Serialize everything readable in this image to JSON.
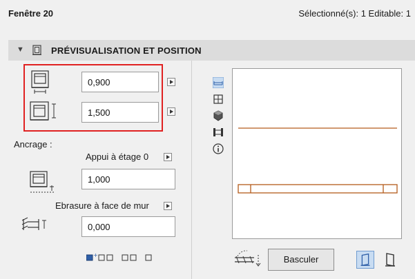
{
  "header": {
    "title": "Fenêtre 20",
    "status": "Sélectionné(s): 1 Editable: 1"
  },
  "section": {
    "title": "PRÉVISUALISATION ET POSITION",
    "expanded": true
  },
  "dimensions": {
    "width_value": "0,900",
    "height_value": "1,500"
  },
  "anchor": {
    "label": "Ancrage :",
    "reference_label": "Appui à étage 0",
    "reference_value": "1,000",
    "reveal_label": "Ebrasure à face de mur",
    "reveal_value": "0,000"
  },
  "preview": {
    "flip_button": "Basculer"
  },
  "colors": {
    "highlight": "#e02020",
    "preview_line": "#b35a1a",
    "toggle_active": "#c8dcf2"
  }
}
